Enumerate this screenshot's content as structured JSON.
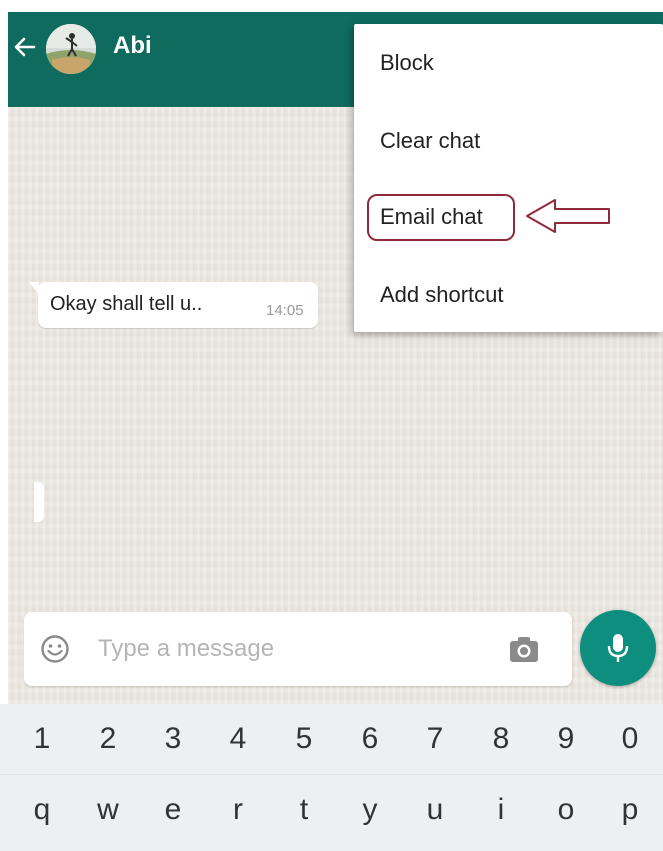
{
  "header": {
    "contact_name": "Abi",
    "background_color": "#0e6b5e"
  },
  "menu": {
    "items": [
      {
        "label": "Block"
      },
      {
        "label": "Clear chat"
      },
      {
        "label": "Email chat"
      },
      {
        "label": "Add shortcut"
      }
    ],
    "highlighted_item": "Email chat"
  },
  "messages": [
    {
      "text": "Okay shall tell u..",
      "time": "14:05"
    }
  ],
  "composer": {
    "placeholder": "Type a message",
    "value": "",
    "accent_color": "#0e8e7e"
  },
  "keyboard": {
    "number_row": [
      "1",
      "2",
      "3",
      "4",
      "5",
      "6",
      "7",
      "8",
      "9",
      "0"
    ],
    "letter_row": [
      "q",
      "w",
      "e",
      "r",
      "t",
      "y",
      "u",
      "i",
      "o",
      "p"
    ]
  },
  "icons": {
    "back": "arrow-left-icon",
    "emoji": "emoji-icon",
    "camera": "camera-icon",
    "mic": "microphone-icon"
  }
}
